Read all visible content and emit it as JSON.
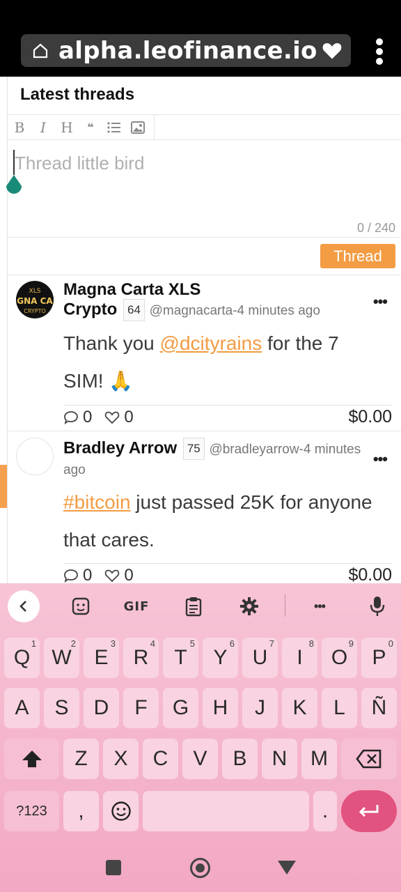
{
  "browser": {
    "url": "alpha.leofinance.io/...",
    "home_icon": "home-icon",
    "heart_icon": "heart-icon",
    "menu_icon": "more-vert-icon"
  },
  "page": {
    "section_title": "Latest threads",
    "toolbar": {
      "bold": "B",
      "italic": "I",
      "heading": "H",
      "quote": "❝",
      "list": "list-icon",
      "image": "image-icon"
    },
    "editor": {
      "placeholder": "Thread little bird",
      "counter": "0 / 240"
    },
    "thread_button": "Thread",
    "accent_color": "#f39c43"
  },
  "posts": [
    {
      "author_line1": "Magna Carta XLS",
      "author_line2": "Crypto",
      "reputation": "64",
      "handle_time": "@magnacarta-4 minutes ago",
      "text_before": "Thank you ",
      "mention": "@dcityrains",
      "text_after": " for the 7 SIM! 🙏",
      "comments": "0",
      "likes": "0",
      "amount": "$0.00",
      "more": "•••",
      "avatar_text": "GNA CA"
    },
    {
      "author_line1": "Bradley Arrow",
      "reputation": "75",
      "handle_time": "@bradleyarrow-4 minutes",
      "handle_time2": "ago",
      "hashtag": "#bitcoin",
      "text_after": " just passed 25K for anyone that cares.",
      "comments": "0",
      "likes": "0",
      "amount": "$0.00",
      "more": "•••"
    }
  ],
  "keyboard": {
    "toolbar": {
      "back": "chevron-left-icon",
      "sticker": "sticker-icon",
      "gif": "GIF",
      "clipboard": "clipboard-icon",
      "settings": "gear-icon",
      "more": "•••",
      "mic": "mic-icon"
    },
    "row1": [
      "Q",
      "W",
      "E",
      "R",
      "T",
      "Y",
      "U",
      "I",
      "O",
      "P"
    ],
    "row1_nums": [
      "1",
      "2",
      "3",
      "4",
      "5",
      "6",
      "7",
      "8",
      "9",
      "0"
    ],
    "row2": [
      "A",
      "S",
      "D",
      "F",
      "G",
      "H",
      "J",
      "K",
      "L",
      "Ñ"
    ],
    "row3": [
      "Z",
      "X",
      "C",
      "V",
      "B",
      "N",
      "M"
    ],
    "symbols": "?123",
    "comma": ",",
    "period": "."
  }
}
